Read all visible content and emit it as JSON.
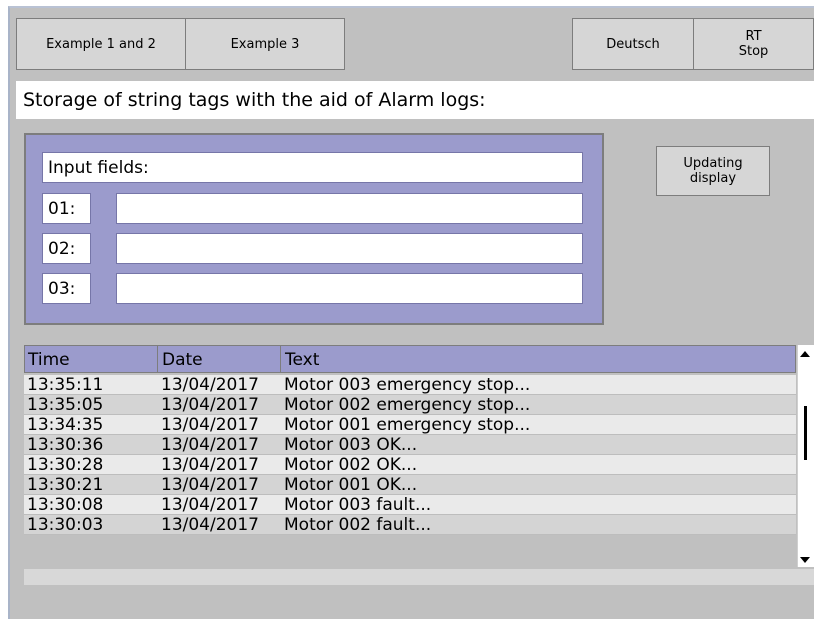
{
  "toolbar": {
    "example12_label": "Example 1 and 2",
    "example3_label": "Example 3",
    "deutsch_label": "Deutsch",
    "rt_line1": "RT",
    "rt_line2": "Stop"
  },
  "heading": "Storage of string tags with the aid of Alarm logs:",
  "input_panel": {
    "header": "Input fields:",
    "rows": [
      {
        "label": "01:",
        "value": ""
      },
      {
        "label": "02:",
        "value": ""
      },
      {
        "label": "03:",
        "value": ""
      }
    ]
  },
  "update_button": {
    "line1": "Updating",
    "line2": "display"
  },
  "log": {
    "columns": [
      "Time",
      "Date",
      "Text"
    ],
    "rows": [
      {
        "time": "13:35:11",
        "date": "13/04/2017",
        "text": "Motor 003 emergency stop..."
      },
      {
        "time": "13:35:05",
        "date": "13/04/2017",
        "text": "Motor 002 emergency stop..."
      },
      {
        "time": "13:34:35",
        "date": "13/04/2017",
        "text": "Motor 001 emergency stop..."
      },
      {
        "time": "13:30:36",
        "date": "13/04/2017",
        "text": "Motor 003 OK..."
      },
      {
        "time": "13:30:28",
        "date": "13/04/2017",
        "text": "Motor 002 OK..."
      },
      {
        "time": "13:30:21",
        "date": "13/04/2017",
        "text": "Motor 001 OK..."
      },
      {
        "time": "13:30:08",
        "date": "13/04/2017",
        "text": "Motor 003 fault..."
      },
      {
        "time": "13:30:03",
        "date": "13/04/2017",
        "text": "Motor 002 fault..."
      }
    ]
  },
  "colors": {
    "background": "#c0c0c0",
    "panel": "#9b9bcc",
    "button": "#d6d6d6"
  }
}
